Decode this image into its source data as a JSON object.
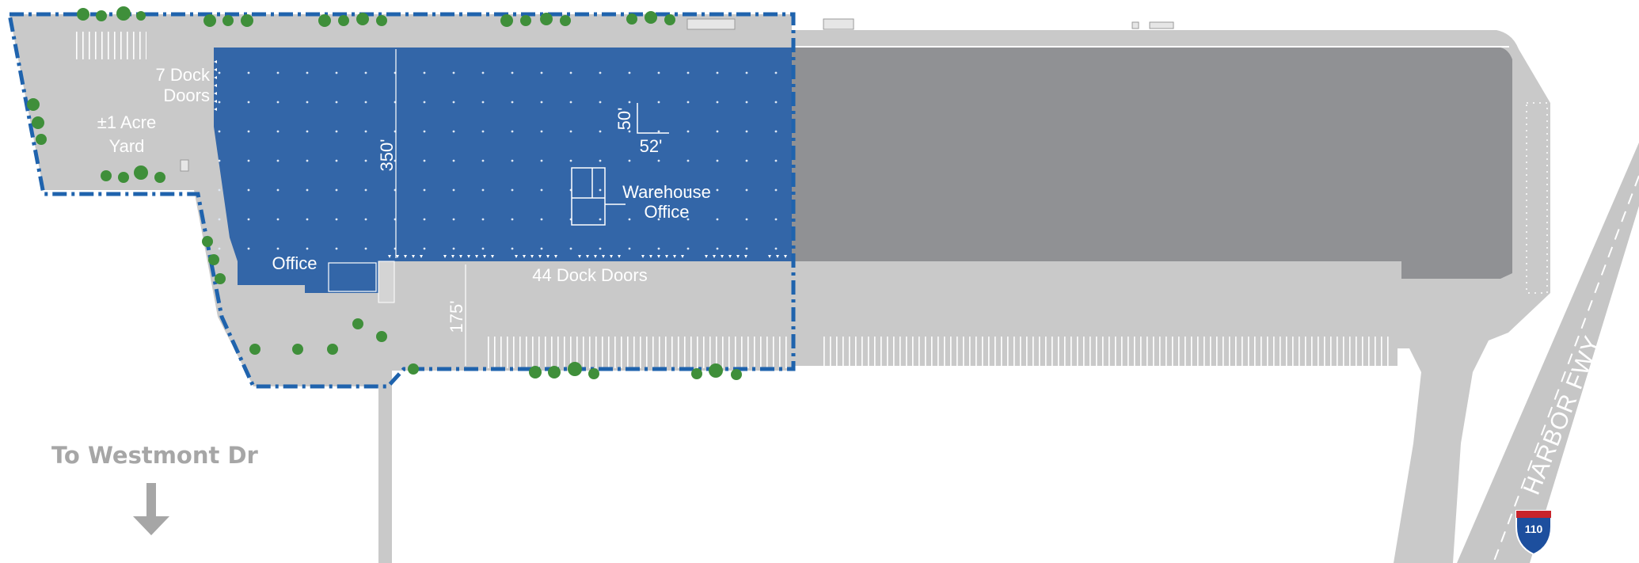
{
  "site_plan": {
    "yard_label_line1": "7 Dock",
    "yard_label_line2": "Doors",
    "acre_label_line1": "±1 Acre",
    "acre_label_line2": "Yard",
    "building_depth": "350'",
    "column_spacing_depth": "50'",
    "column_spacing_width": "52'",
    "warehouse_office_line1": "Warehouse",
    "warehouse_office_line2": "Office",
    "office_label": "Office",
    "dock_doors_label": "44 Dock Doors",
    "truck_court_depth": "175'"
  },
  "directions": {
    "westmont_label": "To Westmont Dr"
  },
  "highway": {
    "name": "HARBOR FWY",
    "shield_number": "110"
  },
  "colors": {
    "leased_building": "#3366a8",
    "outline": "#1f63ad",
    "adjacent_building": "#919294",
    "pavement": "#c8c8c8",
    "label_gray": "#a6a6a6",
    "tree_green": "#3f8f3a"
  }
}
